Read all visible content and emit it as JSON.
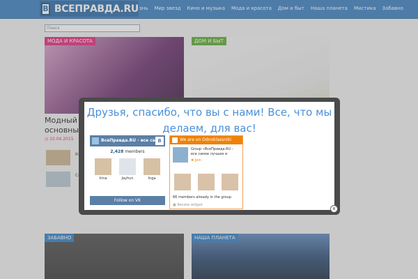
{
  "header": {
    "logo_mark": "В",
    "logo_text": "ВСЕПРАВДА.RU",
    "nav": [
      "знь",
      "Мир звезд",
      "Кино и музыка",
      "Мода и красота",
      "Дом и быт",
      "Наша планета",
      "Мистика",
      "Забавно"
    ]
  },
  "search": {
    "placeholder": "Поиск"
  },
  "cards": {
    "fashion": {
      "category": "МОДА И КРАСОТА",
      "headline_1": "Модный м",
      "headline_2": "основные",
      "date": "10.04.2015"
    },
    "home": {
      "category": "ДОМ И БЫТ"
    },
    "fun": {
      "category": "ЗАБАВНО"
    },
    "planet": {
      "category": "НАША ПЛАНЕТА"
    }
  },
  "side_list": {
    "item_1": "Ко",
    "item_2": "Св"
  },
  "modal": {
    "title": "Друзья, спасибо, что вы с нами! Все, что мы делаем, для вас!",
    "vk": {
      "group_name": "ВсеПравда.RU - все сам...",
      "logo": "В",
      "members_count": "2,428",
      "members_label": "members",
      "members": [
        {
          "name": "Irina"
        },
        {
          "name": "Jayhun"
        },
        {
          "name": "Inga"
        }
      ],
      "button": "Follow on VK"
    },
    "ok": {
      "header": "We are on Odnoklassniki",
      "group_text": "Group «ВсеПравда.RU - все самое лучшее и",
      "join": "Join",
      "members_line": "66 members already in the group",
      "review": "Review widget"
    },
    "close": "x"
  },
  "colors": {
    "topbar": "#3a7ec0",
    "pink": "#e0297a",
    "green": "#5aa82e",
    "vk": "#5b7fa6",
    "ok": "#ee8208",
    "title": "#4a90d9"
  }
}
